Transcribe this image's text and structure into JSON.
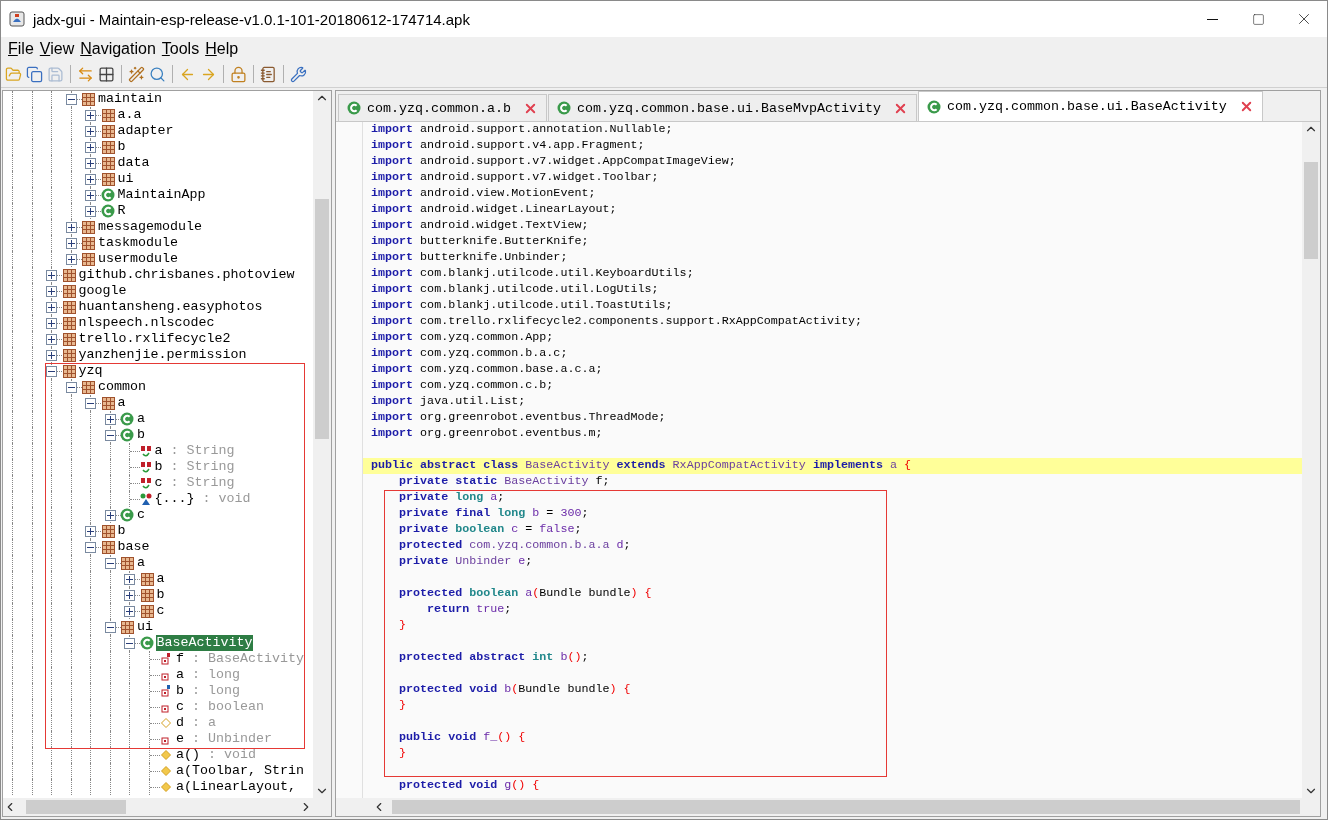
{
  "window": {
    "title": "jadx-gui - Maintain-esp-release-v1.0.1-101-20180612-174714.apk"
  },
  "menu": [
    {
      "label": "File"
    },
    {
      "label": "View"
    },
    {
      "label": "Navigation"
    },
    {
      "label": "Tools"
    },
    {
      "label": "Help"
    }
  ],
  "toolbar": [
    {
      "kind": "open"
    },
    {
      "kind": "save_all"
    },
    {
      "kind": "save",
      "disabled": true
    },
    {
      "kind": "sep"
    },
    {
      "kind": "sync"
    },
    {
      "kind": "flatten"
    },
    {
      "kind": "sep"
    },
    {
      "kind": "decompile"
    },
    {
      "kind": "search"
    },
    {
      "kind": "sep"
    },
    {
      "kind": "back"
    },
    {
      "kind": "forward"
    },
    {
      "kind": "sep"
    },
    {
      "kind": "deobf"
    },
    {
      "kind": "sep"
    },
    {
      "kind": "log"
    },
    {
      "kind": "sep"
    },
    {
      "kind": "prefs"
    }
  ],
  "tree": {
    "items": [
      {
        "children": [
          {
            "label": "maintain",
            "kind": "pkg",
            "expanded": true,
            "selected": false,
            "children": [
              {
                "label": "a.a",
                "kind": "pkg",
                "expanded": false,
                "selected": false
              },
              {
                "label": "adapter",
                "kind": "pkg",
                "expanded": false,
                "selected": false
              },
              {
                "label": "b",
                "kind": "pkg",
                "expanded": false,
                "selected": false
              },
              {
                "label": "data",
                "kind": "pkg",
                "expanded": false,
                "selected": false
              },
              {
                "label": "ui",
                "kind": "pkg",
                "expanded": false,
                "selected": false
              },
              {
                "label": "MaintainApp",
                "kind": "class",
                "expanded": false,
                "selected": false
              },
              {
                "label": "R",
                "kind": "class",
                "expanded": false,
                "selected": false
              }
            ]
          },
          {
            "label": "messagemodule",
            "kind": "pkg",
            "expanded": false,
            "selected": false
          },
          {
            "label": "taskmodule",
            "kind": "pkg",
            "expanded": false,
            "selected": false
          },
          {
            "label": "usermodule",
            "kind": "pkg",
            "expanded": false,
            "selected": false
          }
        ]
      },
      {
        "label": "github.chrisbanes.photoview",
        "kind": "pkg",
        "expanded": false,
        "selected": false
      },
      {
        "label": "google",
        "kind": "pkg",
        "expanded": false,
        "selected": false
      },
      {
        "label": "huantansheng.easyphotos",
        "kind": "pkg",
        "expanded": false,
        "selected": false
      },
      {
        "label": "nlspeech.nlscodec",
        "kind": "pkg",
        "expanded": false,
        "selected": false
      },
      {
        "label": "trello.rxlifecycle2",
        "kind": "pkg",
        "expanded": false,
        "selected": false
      },
      {
        "label": "yanzhenjie.permission",
        "kind": "pkg",
        "expanded": false,
        "selected": false
      },
      {
        "label": "yzq",
        "kind": "pkg",
        "expanded": true,
        "selected": false,
        "children": [
          {
            "label": "common",
            "kind": "pkg",
            "expanded": true,
            "selected": false,
            "children": [
              {
                "label": "a",
                "kind": "pkg",
                "expanded": true,
                "selected": false,
                "children": [
                  {
                    "label": "a",
                    "kind": "class",
                    "expanded": false,
                    "selected": false
                  },
                  {
                    "label": "b",
                    "kind": "class",
                    "expanded": true,
                    "selected": false,
                    "children": [
                      {
                        "label": "a",
                        "value_type": " : String",
                        "kind": "field_static_final",
                        "selected": false
                      },
                      {
                        "label": "b",
                        "value_type": " : String",
                        "kind": "field_static_final",
                        "selected": false
                      },
                      {
                        "label": "c",
                        "value_type": " : String",
                        "kind": "field_static_final",
                        "selected": false
                      },
                      {
                        "label": "{...}",
                        "value_type": " : void",
                        "kind": "static_init",
                        "selected": false
                      }
                    ]
                  },
                  {
                    "label": "c",
                    "kind": "class",
                    "expanded": false,
                    "selected": false
                  }
                ]
              },
              {
                "label": "b",
                "kind": "pkg",
                "expanded": false,
                "selected": false
              },
              {
                "label": "base",
                "kind": "pkg",
                "expanded": true,
                "selected": false,
                "children": [
                  {
                    "label": "a",
                    "kind": "pkg",
                    "expanded": true,
                    "selected": false,
                    "children": [
                      {
                        "label": "a",
                        "kind": "pkg",
                        "expanded": false,
                        "selected": false
                      },
                      {
                        "label": "b",
                        "kind": "pkg",
                        "expanded": false,
                        "selected": false
                      },
                      {
                        "label": "c",
                        "kind": "pkg",
                        "expanded": false,
                        "selected": false
                      }
                    ]
                  },
                  {
                    "label": "ui",
                    "kind": "pkg",
                    "expanded": true,
                    "selected": false,
                    "children": [
                      {
                        "label": "BaseActivity",
                        "kind": "class",
                        "expanded": true,
                        "selected": true,
                        "children": [
                          {
                            "label": "f",
                            "value_type": " : BaseActivity",
                            "kind": "field_static",
                            "selected": false
                          },
                          {
                            "label": "a",
                            "value_type": " : long",
                            "kind": "field",
                            "selected": false
                          },
                          {
                            "label": "b",
                            "value_type": " : long",
                            "kind": "field_final",
                            "selected": false
                          },
                          {
                            "label": "c",
                            "value_type": " : boolean",
                            "kind": "field",
                            "selected": false
                          },
                          {
                            "label": "d",
                            "value_type": " : a",
                            "kind": "field_package",
                            "selected": false
                          },
                          {
                            "label": "e",
                            "value_type": " : Unbinder",
                            "kind": "field",
                            "selected": false
                          },
                          {
                            "label": "a()",
                            "value_type": " : void",
                            "kind": "method",
                            "selected": false
                          },
                          {
                            "label": "a(Toolbar, Strin",
                            "kind": "method",
                            "selected": false
                          },
                          {
                            "label": "a(LinearLayout,",
                            "kind": "method",
                            "selected": false
                          }
                        ]
                      }
                    ]
                  }
                ]
              }
            ]
          }
        ]
      }
    ]
  },
  "tabs": [
    {
      "label": "com.yzq.common.a.b",
      "selected": false
    },
    {
      "label": "com.yzq.common.base.ui.BaseMvpActivity",
      "selected": false
    },
    {
      "label": "com.yzq.common.base.ui.BaseActivity",
      "selected": true
    }
  ],
  "code": {
    "lines": [
      {
        "highlighted": false,
        "tokens": [
          {
            "kind": "kw",
            "text": "import"
          },
          {
            "kind": "plain",
            "text": " android.support.annotation.Nullable;"
          }
        ]
      },
      {
        "highlighted": false,
        "tokens": [
          {
            "kind": "kw",
            "text": "import"
          },
          {
            "kind": "plain",
            "text": " android.support.v4.app.Fragment;"
          }
        ]
      },
      {
        "highlighted": false,
        "tokens": [
          {
            "kind": "kw",
            "text": "import"
          },
          {
            "kind": "plain",
            "text": " android.support.v7.widget.AppCompatImageView;"
          }
        ]
      },
      {
        "highlighted": false,
        "tokens": [
          {
            "kind": "kw",
            "text": "import"
          },
          {
            "kind": "plain",
            "text": " android.support.v7.widget.Toolbar;"
          }
        ]
      },
      {
        "highlighted": false,
        "tokens": [
          {
            "kind": "kw",
            "text": "import"
          },
          {
            "kind": "plain",
            "text": " android.view.MotionEvent;"
          }
        ]
      },
      {
        "highlighted": false,
        "tokens": [
          {
            "kind": "kw",
            "text": "import"
          },
          {
            "kind": "plain",
            "text": " android.widget.LinearLayout;"
          }
        ]
      },
      {
        "highlighted": false,
        "tokens": [
          {
            "kind": "kw",
            "text": "import"
          },
          {
            "kind": "plain",
            "text": " android.widget.TextView;"
          }
        ]
      },
      {
        "highlighted": false,
        "tokens": [
          {
            "kind": "kw",
            "text": "import"
          },
          {
            "kind": "plain",
            "text": " butterknife.ButterKnife;"
          }
        ]
      },
      {
        "highlighted": false,
        "tokens": [
          {
            "kind": "kw",
            "text": "import"
          },
          {
            "kind": "plain",
            "text": " butterknife.Unbinder;"
          }
        ]
      },
      {
        "highlighted": false,
        "tokens": [
          {
            "kind": "kw",
            "text": "import"
          },
          {
            "kind": "plain",
            "text": " com.blankj.utilcode.util.KeyboardUtils;"
          }
        ]
      },
      {
        "highlighted": false,
        "tokens": [
          {
            "kind": "kw",
            "text": "import"
          },
          {
            "kind": "plain",
            "text": " com.blankj.utilcode.util.LogUtils;"
          }
        ]
      },
      {
        "highlighted": false,
        "tokens": [
          {
            "kind": "kw",
            "text": "import"
          },
          {
            "kind": "plain",
            "text": " com.blankj.utilcode.util.ToastUtils;"
          }
        ]
      },
      {
        "highlighted": false,
        "tokens": [
          {
            "kind": "kw",
            "text": "import"
          },
          {
            "kind": "plain",
            "text": " com.trello.rxlifecycle2.components.support.RxAppCompatActivity;"
          }
        ]
      },
      {
        "highlighted": false,
        "tokens": [
          {
            "kind": "kw",
            "text": "import"
          },
          {
            "kind": "plain",
            "text": " com.yzq.common.App;"
          }
        ]
      },
      {
        "highlighted": false,
        "tokens": [
          {
            "kind": "kw",
            "text": "import"
          },
          {
            "kind": "plain",
            "text": " com.yzq.common.b.a.c;"
          }
        ]
      },
      {
        "highlighted": false,
        "tokens": [
          {
            "kind": "kw",
            "text": "import"
          },
          {
            "kind": "plain",
            "text": " com.yzq.common.base.a.c.a;"
          }
        ]
      },
      {
        "highlighted": false,
        "tokens": [
          {
            "kind": "kw",
            "text": "import"
          },
          {
            "kind": "plain",
            "text": " com.yzq.common.c.b;"
          }
        ]
      },
      {
        "highlighted": false,
        "tokens": [
          {
            "kind": "kw",
            "text": "import"
          },
          {
            "kind": "plain",
            "text": " java.util.List;"
          }
        ]
      },
      {
        "highlighted": false,
        "tokens": [
          {
            "kind": "kw",
            "text": "import"
          },
          {
            "kind": "plain",
            "text": " org.greenrobot.eventbus.ThreadMode;"
          }
        ]
      },
      {
        "highlighted": false,
        "tokens": [
          {
            "kind": "kw",
            "text": "import"
          },
          {
            "kind": "plain",
            "text": " org.greenrobot.eventbus.m;"
          }
        ]
      },
      {
        "highlighted": false
      },
      {
        "highlighted": true,
        "tokens": [
          {
            "kind": "kw",
            "text": "public abstract class"
          },
          {
            "kind": "cls",
            "text": " BaseActivity"
          },
          {
            "kind": "kw",
            "text": " extends"
          },
          {
            "kind": "cls",
            "text": " RxAppCompatActivity"
          },
          {
            "kind": "kw",
            "text": " implements"
          },
          {
            "kind": "cls",
            "text": " a"
          },
          {
            "kind": "sym",
            "text": " {"
          }
        ]
      },
      {
        "highlighted": false,
        "tokens": [
          {
            "kind": "kw",
            "text": "    private static"
          },
          {
            "kind": "cls",
            "text": " BaseActivity"
          },
          {
            "kind": "plain",
            "text": " f;"
          }
        ]
      },
      {
        "highlighted": false,
        "tokens": [
          {
            "kind": "kw",
            "text": "    private"
          },
          {
            "kind": "type",
            "text": " long"
          },
          {
            "kind": "id",
            "text": " a"
          },
          {
            "kind": "plain",
            "text": ";"
          }
        ]
      },
      {
        "highlighted": false,
        "tokens": [
          {
            "kind": "kw",
            "text": "    private final"
          },
          {
            "kind": "type",
            "text": " long"
          },
          {
            "kind": "id",
            "text": " b"
          },
          {
            "kind": "plain",
            "text": " ="
          },
          {
            "kind": "id",
            "text": " 300"
          },
          {
            "kind": "plain",
            "text": ";"
          }
        ]
      },
      {
        "highlighted": false,
        "tokens": [
          {
            "kind": "kw",
            "text": "    private"
          },
          {
            "kind": "type",
            "text": " boolean"
          },
          {
            "kind": "id",
            "text": " c"
          },
          {
            "kind": "plain",
            "text": " ="
          },
          {
            "kind": "id",
            "text": " false"
          },
          {
            "kind": "plain",
            "text": ";"
          }
        ]
      },
      {
        "highlighted": false,
        "tokens": [
          {
            "kind": "kw",
            "text": "    protected"
          },
          {
            "kind": "cls",
            "text": " com.yzq.common.b.a.a"
          },
          {
            "kind": "id",
            "text": " d"
          },
          {
            "kind": "plain",
            "text": ";"
          }
        ]
      },
      {
        "highlighted": false,
        "tokens": [
          {
            "kind": "kw",
            "text": "    private"
          },
          {
            "kind": "cls",
            "text": " Unbinder"
          },
          {
            "kind": "id",
            "text": " e"
          },
          {
            "kind": "plain",
            "text": ";"
          }
        ]
      },
      {
        "highlighted": false
      },
      {
        "highlighted": false,
        "tokens": [
          {
            "kind": "kw",
            "text": "    protected"
          },
          {
            "kind": "type",
            "text": " boolean"
          },
          {
            "kind": "id",
            "text": " a"
          },
          {
            "kind": "sym",
            "text": "("
          },
          {
            "kind": "plain",
            "text": "Bundle bundle"
          },
          {
            "kind": "sym",
            "text": ")"
          },
          {
            "kind": "sym",
            "text": " {"
          }
        ]
      },
      {
        "highlighted": false,
        "tokens": [
          {
            "kind": "kw",
            "text": "        return"
          },
          {
            "kind": "id",
            "text": " true"
          },
          {
            "kind": "plain",
            "text": ";"
          }
        ]
      },
      {
        "highlighted": false,
        "tokens": [
          {
            "kind": "sym",
            "text": "    }"
          }
        ]
      },
      {
        "highlighted": false
      },
      {
        "highlighted": false,
        "tokens": [
          {
            "kind": "kw",
            "text": "    protected abstract"
          },
          {
            "kind": "type",
            "text": " int"
          },
          {
            "kind": "id",
            "text": " b"
          },
          {
            "kind": "sym",
            "text": "()"
          },
          {
            "kind": "plain",
            "text": ";"
          }
        ]
      },
      {
        "highlighted": false
      },
      {
        "highlighted": false,
        "tokens": [
          {
            "kind": "kw",
            "text": "    protected void"
          },
          {
            "kind": "id",
            "text": " b"
          },
          {
            "kind": "sym",
            "text": "("
          },
          {
            "kind": "plain",
            "text": "Bundle bundle"
          },
          {
            "kind": "sym",
            "text": ")"
          },
          {
            "kind": "sym",
            "text": " {"
          }
        ]
      },
      {
        "highlighted": false,
        "tokens": [
          {
            "kind": "sym",
            "text": "    }"
          }
        ]
      },
      {
        "highlighted": false
      },
      {
        "highlighted": false,
        "tokens": [
          {
            "kind": "kw",
            "text": "    public void"
          },
          {
            "kind": "id",
            "text": " f_"
          },
          {
            "kind": "sym",
            "text": "()"
          },
          {
            "kind": "sym",
            "text": " {"
          }
        ]
      },
      {
        "highlighted": false,
        "tokens": [
          {
            "kind": "sym",
            "text": "    }"
          }
        ]
      },
      {
        "highlighted": false
      },
      {
        "highlighted": false,
        "tokens": [
          {
            "kind": "kw",
            "text": "    protected void"
          },
          {
            "kind": "id",
            "text": " g"
          },
          {
            "kind": "sym",
            "text": "()"
          },
          {
            "kind": "sym",
            "text": " {"
          }
        ]
      }
    ]
  }
}
